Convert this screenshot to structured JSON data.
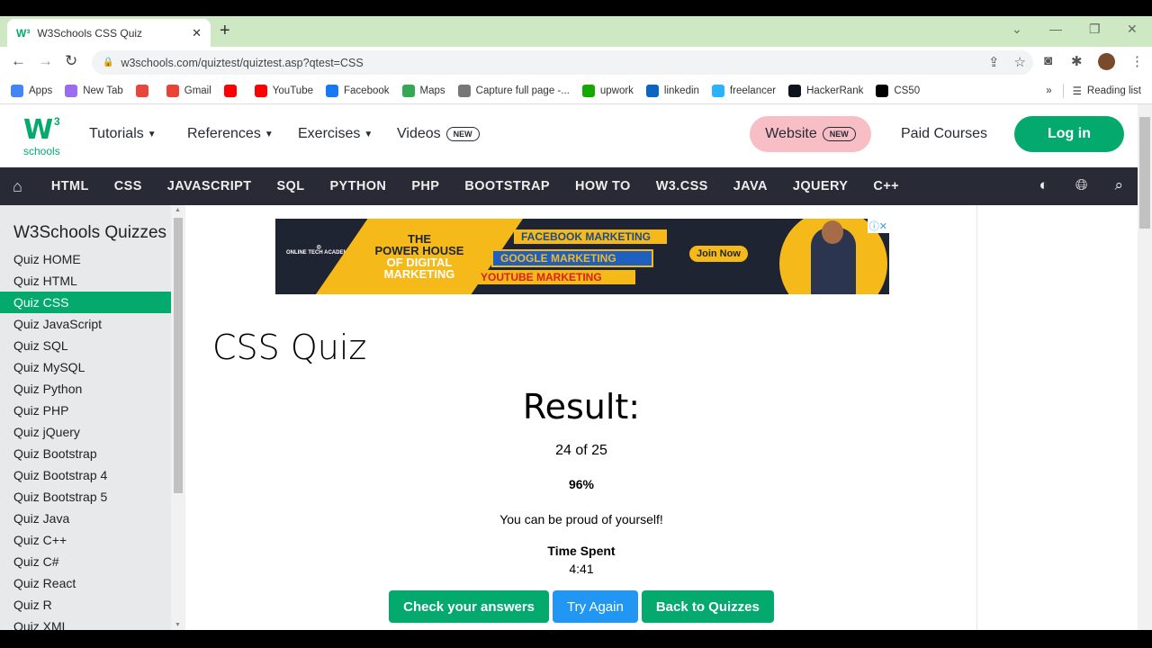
{
  "browser": {
    "tab_title": "W3Schools CSS Quiz",
    "tab_favicon": "W³",
    "url": "w3schools.com/quiztest/quiztest.asp?qtest=CSS",
    "bookmarks": [
      {
        "label": "Apps",
        "icon": "apps-grid-icon",
        "color": "#4285f4"
      },
      {
        "label": "New Tab",
        "icon": "new-tab-icon",
        "color": "#9c6cf0"
      },
      {
        "label": "",
        "icon": "d-icon",
        "color": "#e8453c"
      },
      {
        "label": "Gmail",
        "icon": "gmail-icon",
        "color": "#ea4335"
      },
      {
        "label": "",
        "icon": "youtube-icon",
        "color": "#ff0000"
      },
      {
        "label": "YouTube",
        "icon": "youtube-icon",
        "color": "#ff0000"
      },
      {
        "label": "Facebook",
        "icon": "facebook-icon",
        "color": "#1877f2"
      },
      {
        "label": "Maps",
        "icon": "maps-pin-icon",
        "color": "#34a853"
      },
      {
        "label": "Capture full page -...",
        "icon": "capture-icon",
        "color": "#777777"
      },
      {
        "label": "upwork",
        "icon": "upwork-icon",
        "color": "#14a800"
      },
      {
        "label": "linkedin",
        "icon": "linkedin-icon",
        "color": "#0a66c2"
      },
      {
        "label": "freelancer",
        "icon": "freelancer-icon",
        "color": "#29b2fe"
      },
      {
        "label": "HackerRank",
        "icon": "hackerrank-icon",
        "color": "#0e141e"
      },
      {
        "label": "CS50",
        "icon": "cs50-icon",
        "color": "#000000"
      }
    ],
    "more_bookmarks": "»",
    "reading_list": "Reading list"
  },
  "header": {
    "logo_letter": "W",
    "logo_sup": "3",
    "logo_text": "schools",
    "nav": [
      {
        "label": "Tutorials",
        "dropdown": true
      },
      {
        "label": "References",
        "dropdown": true
      },
      {
        "label": "Exercises",
        "dropdown": true
      },
      {
        "label": "Videos",
        "badge": "NEW"
      }
    ],
    "website_label": "Website",
    "website_badge": "NEW",
    "paid_courses": "Paid Courses",
    "login": "Log in"
  },
  "darknav": {
    "items": [
      "HTML",
      "CSS",
      "JAVASCRIPT",
      "SQL",
      "PYTHON",
      "PHP",
      "BOOTSTRAP",
      "HOW TO",
      "W3.CSS",
      "JAVA",
      "JQUERY",
      "C++"
    ]
  },
  "sidebar": {
    "title": "W3Schools Quizzes",
    "active_index": 2,
    "items": [
      "Quiz HOME",
      "Quiz HTML",
      "Quiz CSS",
      "Quiz JavaScript",
      "Quiz SQL",
      "Quiz MySQL",
      "Quiz Python",
      "Quiz PHP",
      "Quiz jQuery",
      "Quiz Bootstrap",
      "Quiz Bootstrap 4",
      "Quiz Bootstrap 5",
      "Quiz Java",
      "Quiz C++",
      "Quiz C#",
      "Quiz React",
      "Quiz R",
      "Quiz XML"
    ]
  },
  "ad": {
    "headline_1": "THE",
    "headline_2": "POWER HOUSE",
    "headline_3": "OF DIGITAL",
    "headline_4": "MARKETING",
    "bar_1": "FACEBOOK MARKETING",
    "bar_2": "GOOGLE MARKETING",
    "bar_3": "YOUTUBE MARKETING",
    "cta": "Join Now",
    "brand": "ONLINE TECH ACADEMY"
  },
  "main": {
    "title": "CSS Quiz",
    "result_heading": "Result:",
    "score": "24 of 25",
    "percent": "96%",
    "message": "You can be proud of yourself!",
    "time_label": "Time Spent",
    "time_value": "4:41",
    "buttons": {
      "check": "Check your answers",
      "retry": "Try Again",
      "back": "Back to Quizzes"
    }
  },
  "colors": {
    "brand_green": "#04aa6d",
    "dark_nav": "#282a35",
    "try_again_blue": "#2196f3",
    "website_pink": "#f7bec5",
    "tabstrip_green": "#cde8c3"
  }
}
